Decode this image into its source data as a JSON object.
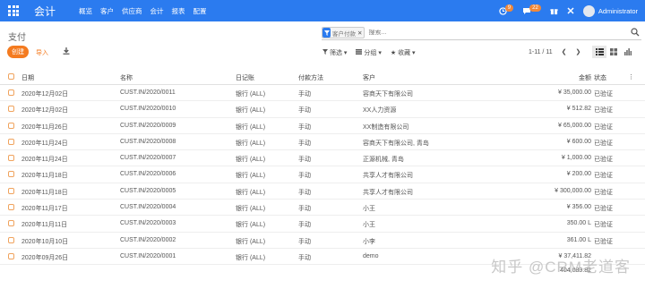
{
  "navbar": {
    "brand": "会计",
    "menu": [
      "概览",
      "客户",
      "供应商",
      "会计",
      "报表",
      "配置"
    ],
    "activity_badge": "9",
    "message_badge": "22",
    "user": "Administrator"
  },
  "breadcrumb": "支付",
  "search": {
    "facet": "客户付款",
    "placeholder": "搜索..."
  },
  "buttons": {
    "create": "创建",
    "import": "导入"
  },
  "filters": {
    "filter": "筛选",
    "group": "分组",
    "favorite": "收藏"
  },
  "pager": "1-11 / 11",
  "table": {
    "headers": [
      "日期",
      "名称",
      "日记账",
      "付款方法",
      "客户",
      "金额",
      "状态"
    ],
    "rows": [
      {
        "date": "2020年12月02日",
        "name": "CUST.IN/2020/0011",
        "journal": "银行 (ALL)",
        "method": "手动",
        "partner": "容商天下有限公司",
        "amount": "¥ 35,000.00",
        "status": "已验证"
      },
      {
        "date": "2020年12月02日",
        "name": "CUST.IN/2020/0010",
        "journal": "银行 (ALL)",
        "method": "手动",
        "partner": "XX人力资源",
        "amount": "¥ 512.82",
        "status": "已验证"
      },
      {
        "date": "2020年11月26日",
        "name": "CUST.IN/2020/0009",
        "journal": "银行 (ALL)",
        "method": "手动",
        "partner": "XX制造有限公司",
        "amount": "¥ 65,000.00",
        "status": "已验证"
      },
      {
        "date": "2020年11月24日",
        "name": "CUST.IN/2020/0008",
        "journal": "银行 (ALL)",
        "method": "手动",
        "partner": "容商天下有限公司, 青岛",
        "amount": "¥ 600.00",
        "status": "已验证"
      },
      {
        "date": "2020年11月24日",
        "name": "CUST.IN/2020/0007",
        "journal": "银行 (ALL)",
        "method": "手动",
        "partner": "正源机械, 青岛",
        "amount": "¥ 1,000.00",
        "status": "已验证"
      },
      {
        "date": "2020年11月18日",
        "name": "CUST.IN/2020/0006",
        "journal": "银行 (ALL)",
        "method": "手动",
        "partner": "共享人才有限公司",
        "amount": "¥ 200.00",
        "status": "已验证"
      },
      {
        "date": "2020年11月18日",
        "name": "CUST.IN/2020/0005",
        "journal": "银行 (ALL)",
        "method": "手动",
        "partner": "共享人才有限公司",
        "amount": "¥ 300,000.00",
        "status": "已验证"
      },
      {
        "date": "2020年11月17日",
        "name": "CUST.IN/2020/0004",
        "journal": "银行 (ALL)",
        "method": "手动",
        "partner": "小王",
        "amount": "¥ 356.00",
        "status": "已验证"
      },
      {
        "date": "2020年11月11日",
        "name": "CUST.IN/2020/0003",
        "journal": "银行 (ALL)",
        "method": "手动",
        "partner": "小王",
        "amount": "350.00 L",
        "status": "已验证"
      },
      {
        "date": "2020年10月10日",
        "name": "CUST.IN/2020/0002",
        "journal": "银行 (ALL)",
        "method": "手动",
        "partner": "小李",
        "amount": "361.00 L",
        "status": "已验证"
      },
      {
        "date": "2020年09月26日",
        "name": "CUST.IN/2020/0001",
        "journal": "银行 (ALL)",
        "method": "手动",
        "partner": "demo",
        "amount": "¥ 37,411.82",
        "status": ""
      }
    ],
    "total": "404,089.82"
  },
  "watermark": "知乎 @CRM老道客"
}
